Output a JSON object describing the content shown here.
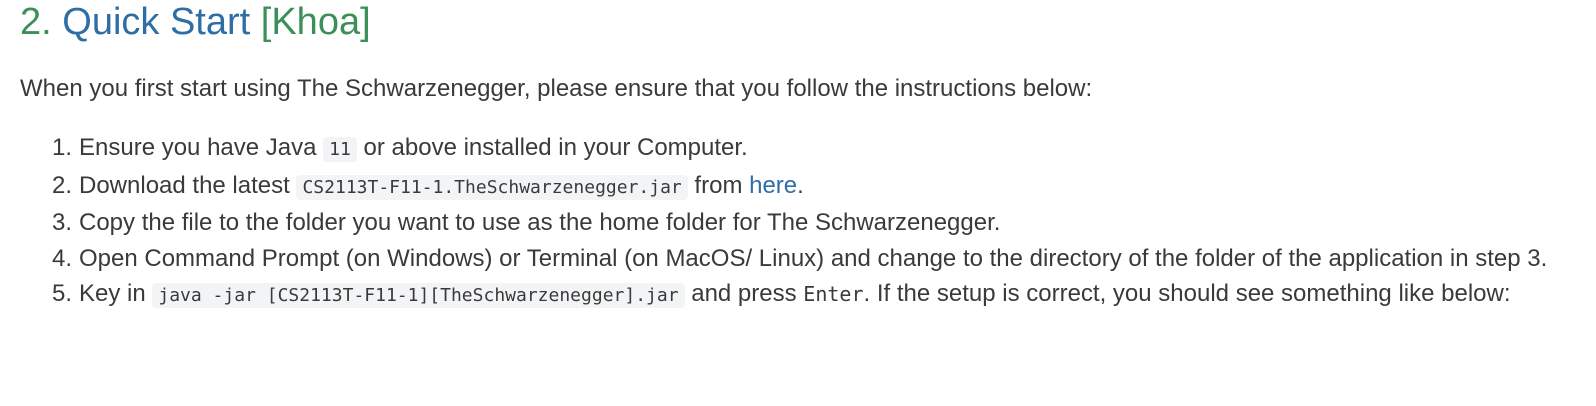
{
  "heading": {
    "number": "2.",
    "title": "Quick Start",
    "tag": "[Khoa]"
  },
  "intro": "When you first start using The Schwarzenegger, please ensure that you follow the instructions below:",
  "steps": [
    {
      "marker": "1.",
      "text_a": "Ensure you have Java ",
      "code": "11",
      "text_b": " or above installed in your Computer."
    },
    {
      "marker": "2.",
      "text_a": "Download the latest ",
      "code": "CS2113T-F11-1.TheSchwarzenegger.jar",
      "text_b": " from ",
      "link": "here",
      "text_c": "."
    },
    {
      "marker": "3.",
      "text": "Copy the file to the folder you want to use as the home folder for The Schwarzenegger."
    },
    {
      "marker": "4.",
      "text": "Open Command Prompt (on Windows) or Terminal (on MacOS/ Linux) and change to the directory of the folder of the application in step 3."
    },
    {
      "marker": "5.",
      "text_a": "Key in ",
      "code": "java -jar [CS2113T-F11-1][TheSchwarzenegger].jar",
      "text_b": " and press ",
      "key": "Enter",
      "text_c": ". If the setup is correct, you should see something like below:"
    }
  ]
}
